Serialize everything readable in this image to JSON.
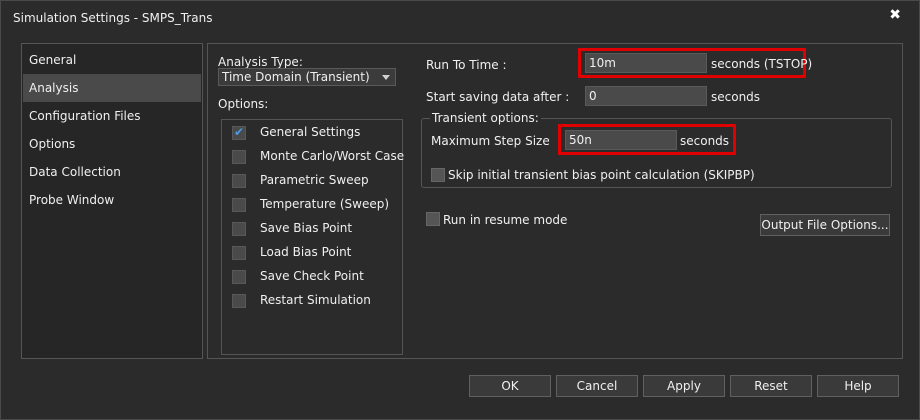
{
  "window": {
    "title": "Simulation Settings - SMPS_Trans",
    "close_glyph": "✖"
  },
  "sidebar": {
    "items": [
      {
        "label": "General"
      },
      {
        "label": "Analysis"
      },
      {
        "label": "Configuration Files"
      },
      {
        "label": "Options"
      },
      {
        "label": "Data Collection"
      },
      {
        "label": "Probe Window"
      }
    ],
    "active": "Analysis"
  },
  "analysis": {
    "type_label": "Analysis Type:",
    "type_value": "Time Domain (Transient)",
    "options_label": "Options:",
    "options": [
      {
        "label": "General Settings",
        "checked": true
      },
      {
        "label": "Monte Carlo/Worst Case",
        "checked": false
      },
      {
        "label": "Parametric Sweep",
        "checked": false
      },
      {
        "label": "Temperature (Sweep)",
        "checked": false
      },
      {
        "label": "Save Bias Point",
        "checked": false
      },
      {
        "label": "Load Bias Point",
        "checked": false
      },
      {
        "label": "Save Check Point",
        "checked": false
      },
      {
        "label": "Restart Simulation",
        "checked": false
      }
    ]
  },
  "settings": {
    "run_to_time_label": "Run To Time :",
    "run_to_time_value": "10m",
    "run_to_time_unit": "seconds (TSTOP)",
    "start_saving_label": "Start saving data after :",
    "start_saving_value": "0",
    "start_saving_unit": "seconds",
    "transient_group_label": "Transient options:",
    "max_step_label": "Maximum Step Size",
    "max_step_value": "50n",
    "max_step_unit": "seconds",
    "skip_bias_label": "Skip initial transient bias point calculation (SKIPBP)",
    "resume_label": "Run in resume mode",
    "output_file_button": "Output File Options..."
  },
  "footer": {
    "ok": "OK",
    "cancel": "Cancel",
    "apply": "Apply",
    "reset": "Reset",
    "help": "Help"
  },
  "colors": {
    "background": "#2b2b2b",
    "highlight": "#e00000",
    "checkmark": "#4b9be6"
  }
}
